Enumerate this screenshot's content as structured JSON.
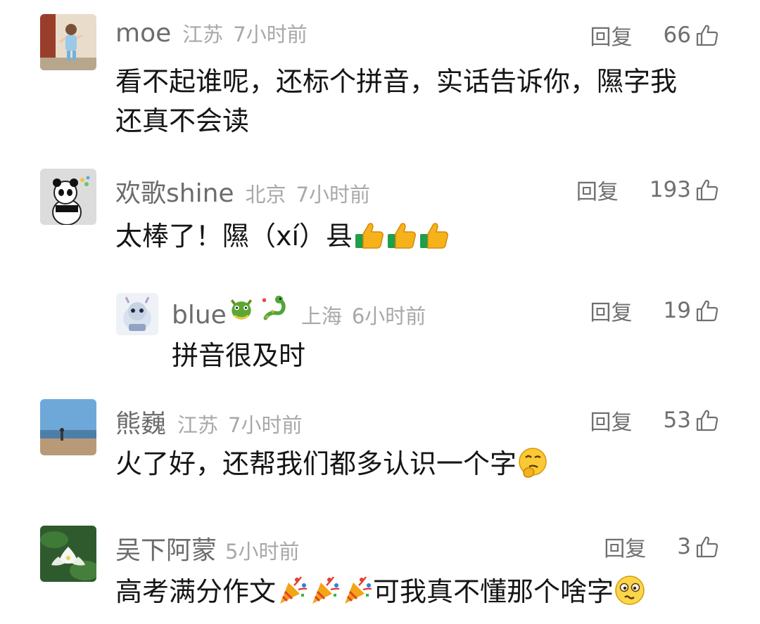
{
  "comments": [
    {
      "name": "moe",
      "location": "江苏",
      "time": "7小时前",
      "reply_label": "回复",
      "likes": "66",
      "body_lines": [
        "看不起谁呢，还标个拼音，实话告诉你，隰字我",
        "还真不会读"
      ],
      "avatar_icon": "child-photo-avatar"
    },
    {
      "name": "欢歌shine",
      "location": "北京",
      "time": "7小时前",
      "reply_label": "回复",
      "likes": "193",
      "body_text": "太棒了！隰（xí）县",
      "emojis": [
        "thumbs-up",
        "thumbs-up",
        "thumbs-up"
      ],
      "avatar_icon": "panda-avatar"
    },
    {
      "name": "blue",
      "name_emojis": [
        "dragon-head",
        "dragon"
      ],
      "location": "上海",
      "time": "6小时前",
      "reply_label": "回复",
      "likes": "19",
      "body_text": "拼音很及时",
      "is_reply": true,
      "avatar_icon": "dragon-toy-avatar"
    },
    {
      "name": "熊巍",
      "location": "江苏",
      "time": "7小时前",
      "reply_label": "回复",
      "likes": "53",
      "body_text": "火了好，还帮我们都多认识一个字",
      "emojis": [
        "thinking-face"
      ],
      "avatar_icon": "beach-photo-avatar"
    },
    {
      "name": "吴下阿蒙",
      "location": "",
      "time": "5小时前",
      "reply_label": "回复",
      "likes": "3",
      "body_text_a": "高考满分作文",
      "body_text_b": "可我真不懂那个啥字",
      "emojis_mid": [
        "party-popper",
        "party-popper",
        "party-popper"
      ],
      "emojis_end": [
        "confused-face"
      ],
      "avatar_icon": "lotus-photo-avatar"
    }
  ],
  "colors": {
    "name": "#6c6c6c",
    "meta": "#a8a8a8",
    "body": "#151515"
  }
}
